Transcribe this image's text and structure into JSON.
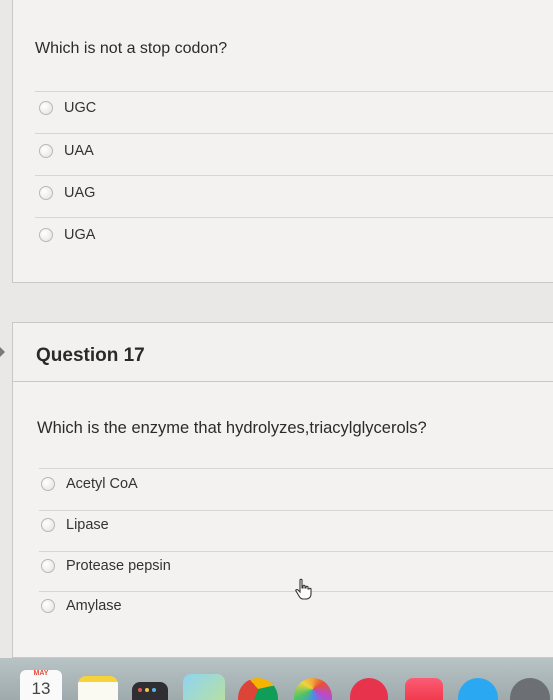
{
  "question16": {
    "text": "Which is not a stop codon?",
    "options": [
      "UGC",
      "UAA",
      "UAG",
      "UGA"
    ]
  },
  "question17": {
    "title": "Question 17",
    "text": "Which is the enzyme that hydrolyzes,triacylglycerols?",
    "options": [
      "Acetyl CoA",
      "Lipase",
      "Protease pepsin",
      "Amylase"
    ]
  },
  "dock": {
    "calendar_month": "MAY",
    "calendar_day": "13",
    "apps": [
      "calendar-icon",
      "notes-icon",
      "launchpad-icon",
      "maps-icon",
      "chrome-icon",
      "photos-icon",
      "news-icon",
      "music-icon",
      "app-store-icon",
      "preferences-icon"
    ]
  },
  "colors": {
    "card_bg": "#f3f2f0",
    "border": "#c9c8c5",
    "text": "#2d2d2d"
  }
}
